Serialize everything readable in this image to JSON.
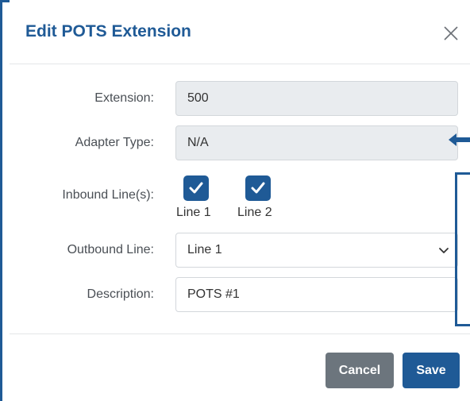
{
  "dialog": {
    "title": "Edit POTS Extension",
    "close_icon": "close-icon"
  },
  "form": {
    "extension": {
      "label": "Extension:",
      "value": "500"
    },
    "adapter_type": {
      "label": "Adapter Type:",
      "value": "N/A"
    },
    "inbound": {
      "label": "Inbound Line(s):",
      "lines": [
        {
          "label": "Line 1",
          "checked": true
        },
        {
          "label": "Line 2",
          "checked": true
        }
      ]
    },
    "outbound": {
      "label": "Outbound Line:",
      "selected": "Line 1"
    },
    "description": {
      "label": "Description:",
      "value": "POTS #1"
    }
  },
  "buttons": {
    "cancel": "Cancel",
    "save": "Save"
  },
  "colors": {
    "accent": "#1f5a96",
    "secondary": "#6c757d",
    "readonly_bg": "#e9ecef"
  }
}
